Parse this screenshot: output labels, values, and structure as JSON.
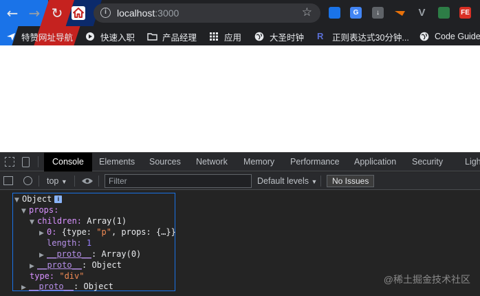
{
  "browser": {
    "url_host": "localhost",
    "url_port": ":3000",
    "colors": {
      "chrome_bg": "#202124",
      "accent_blue": "#1a73e8",
      "accent_red": "#c5221f"
    },
    "extensions": [
      {
        "name": "extension-layers-icon",
        "label": "",
        "color": "#1a73e8"
      },
      {
        "name": "extension-translate-icon",
        "label": "G",
        "color": "#4285f4"
      },
      {
        "name": "extension-download-icon",
        "label": "↓",
        "color": "#5f6368"
      },
      {
        "name": "extension-ruler-icon",
        "label": "",
        "color": "#e8710a"
      },
      {
        "name": "extension-vue-icon",
        "label": "V",
        "color": "#5f6368"
      },
      {
        "name": "extension-terminal-icon",
        "label": "",
        "color": "#2d7d46"
      },
      {
        "name": "extension-fe-icon",
        "label": "FE",
        "color": "#d93025"
      }
    ]
  },
  "bookmarks": [
    {
      "label": "特赞网址导航",
      "icon": "plane-icon"
    },
    {
      "label": "快速入职",
      "icon": "rocket-icon"
    },
    {
      "label": "产品经理",
      "icon": "folder-icon"
    },
    {
      "label": "应用",
      "icon": "apps-grid-icon"
    },
    {
      "label": "大圣时钟",
      "icon": "globe-icon"
    },
    {
      "label": "正则表达式30分钟...",
      "icon": "r-logo-icon"
    },
    {
      "label": "Code Guide",
      "icon": "globe-icon"
    }
  ],
  "devtools": {
    "tabs": [
      "Console",
      "Elements",
      "Sources",
      "Network",
      "Memory",
      "Performance",
      "Application",
      "Security",
      "Ligh"
    ],
    "active_tab": "Console",
    "toolbar": {
      "context": "top",
      "filter_placeholder": "Filter",
      "levels": "Default levels",
      "issues": "No Issues"
    },
    "console": {
      "object_label": "Object",
      "info_badge": "i",
      "props_key": "props:",
      "children_key": "children:",
      "children_value": "Array(1)",
      "item0_key": "0:",
      "item0_prefix": "{type: ",
      "item0_type": "\"p\"",
      "item0_suffix": ", props: {…}}",
      "length_key": "length:",
      "length_value": "1",
      "proto_key": "__proto__",
      "array_proto_value": ": Array(0)",
      "object_proto_value": ": Object",
      "type_key": "type:",
      "type_value": "\"div\""
    }
  },
  "watermark": "@稀土掘金技术社区"
}
